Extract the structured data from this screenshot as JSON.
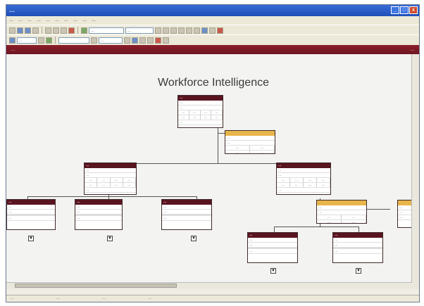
{
  "window": {
    "title": "…",
    "min": "_",
    "max": "□",
    "close": "x"
  },
  "menu": [
    "…",
    "…",
    "…",
    "…",
    "…",
    "…",
    "…",
    "…",
    "…",
    "…"
  ],
  "toolbar": {
    "combo1": "…",
    "combo2": "…",
    "combo3": "…",
    "combo4": "…"
  },
  "header": {
    "left": "…",
    "right": "…"
  },
  "chart": {
    "title": "Workforce Intelligence"
  },
  "nodes": {
    "root": {
      "title": "…",
      "name": "…",
      "role": "…",
      "k": [
        "…",
        "…",
        "…",
        "…"
      ],
      "v": [
        "…",
        "…",
        "…",
        "…"
      ],
      "f": "…"
    },
    "staff": {
      "title": "…",
      "name": "…",
      "k": [
        "…",
        "…"
      ],
      "v": [
        "…",
        "…"
      ]
    },
    "l2a": {
      "title": "…",
      "name": "…",
      "role": "…",
      "k": [
        "…",
        "…",
        "…",
        "…"
      ],
      "v": [
        "…",
        "…",
        "…",
        "…"
      ],
      "f": "…"
    },
    "l2b": {
      "title": "…",
      "name": "…",
      "role": "…",
      "k": [
        "…",
        "…",
        "…",
        "…"
      ],
      "v": [
        "…",
        "…",
        "…",
        "…"
      ],
      "f": "…"
    },
    "c1": {
      "title": "…",
      "name": "…",
      "role": "…",
      "f": "…"
    },
    "c2": {
      "title": "…",
      "name": "…",
      "role": "…",
      "f": "…"
    },
    "c3": {
      "title": "…",
      "name": "…",
      "role": "…",
      "f": "…"
    },
    "c4": {
      "title": "…",
      "name": "…",
      "k": [
        "…",
        "…"
      ],
      "v": [
        "…",
        "…"
      ]
    },
    "c5": {
      "title": "…",
      "name": "…",
      "role": "…"
    },
    "g1": {
      "title": "…",
      "name": "…",
      "role": "…",
      "f": "…"
    },
    "g2": {
      "title": "…",
      "name": "…",
      "role": "…",
      "f": "…"
    }
  },
  "status": [
    "…",
    "…",
    "…",
    "…"
  ]
}
